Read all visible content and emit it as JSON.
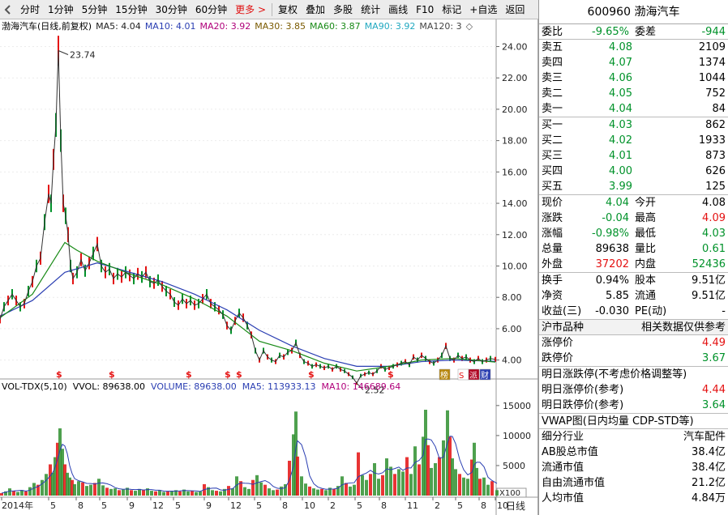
{
  "toolbar": {
    "items": [
      "分时",
      "1分钟",
      "5分钟",
      "15分钟",
      "30分钟",
      "60分钟"
    ],
    "more": "更多 >",
    "actions": [
      "复权",
      "叠加",
      "多股",
      "统计",
      "画线",
      "F10",
      "标记",
      "+自选",
      "返回"
    ]
  },
  "legend": {
    "title": "渤海汽车(日线,前复权)",
    "ma": [
      {
        "label": "MA5: 4.04",
        "color": "#202020"
      },
      {
        "label": "MA10: 4.01",
        "color": "#2a3eb2"
      },
      {
        "label": "MA20: 3.92",
        "color": "#b0007a"
      },
      {
        "label": "MA30: 3.85",
        "color": "#7a5a00"
      },
      {
        "label": "MA60: 3.87",
        "color": "#188a16"
      },
      {
        "label": "MA90: 3.92",
        "color": "#20a8c0"
      },
      {
        "label": "MA120: 3",
        "color": "#444444"
      }
    ]
  },
  "volume_legend": {
    "items": [
      {
        "label": "VOL-TDX(5,10)",
        "color": "#000000"
      },
      {
        "label": "VVOL: 89638.00",
        "color": "#000000"
      },
      {
        "label": "VOLUME: 89638.00",
        "color": "#2a3eb2"
      },
      {
        "label": "MA5: 113933.13",
        "color": "#2a3eb2"
      },
      {
        "label": "MA10: 146689.64",
        "color": "#b0007a"
      }
    ]
  },
  "colors": {
    "up": "#e41111",
    "down": "#00922a",
    "volume_bar_down": "#2f8f2f",
    "accent": "#e01010"
  },
  "chart_data": {
    "type": "line",
    "title": "渤海汽车(日线,前复权)",
    "price_axis": {
      "ticks": [
        "24.00",
        "22.00",
        "20.00",
        "18.00",
        "16.00",
        "14.00",
        "12.00",
        "10.00",
        "8.00",
        "6.00",
        "4.00"
      ],
      "ylim": [
        3.0,
        24.8
      ]
    },
    "volume_axis": {
      "ticks": [
        "15000",
        "10000",
        "5000"
      ],
      "unit": "X100",
      "ylim": [
        0,
        17000
      ]
    },
    "x_axis": {
      "labels": [
        "2014年",
        "5",
        "8",
        "5",
        "9",
        "12",
        "5",
        "9",
        "12",
        "5",
        "8",
        "10",
        "2",
        "5",
        "8",
        "11",
        "2",
        "5",
        "8",
        "10"
      ],
      "period": "日线"
    },
    "max_label": "23.74",
    "min_label": "2.52",
    "price_path": [
      [
        0,
        6.6
      ],
      [
        5,
        7.4
      ],
      [
        10,
        7.8
      ],
      [
        15,
        8.2
      ],
      [
        20,
        7.8
      ],
      [
        25,
        7.4
      ],
      [
        30,
        7.6
      ],
      [
        35,
        8.4
      ],
      [
        40,
        9.0
      ],
      [
        45,
        10.0
      ],
      [
        50,
        10.5
      ],
      [
        55,
        12.8
      ],
      [
        60,
        14.6
      ],
      [
        63,
        14.0
      ],
      [
        66,
        16.8
      ],
      [
        69,
        19.0
      ],
      [
        72,
        23.74
      ],
      [
        75,
        18.0
      ],
      [
        78,
        14.0
      ],
      [
        81,
        13.2
      ],
      [
        84,
        12.0
      ],
      [
        87,
        10.0
      ],
      [
        90,
        9.2
      ],
      [
        95,
        9.6
      ],
      [
        100,
        10.4
      ],
      [
        105,
        9.7
      ],
      [
        110,
        10.2
      ],
      [
        115,
        10.8
      ],
      [
        120,
        11.4
      ],
      [
        125,
        10.0
      ],
      [
        130,
        9.6
      ],
      [
        135,
        9.8
      ],
      [
        140,
        9.2
      ],
      [
        145,
        9.5
      ],
      [
        150,
        9.3
      ],
      [
        155,
        9.6
      ],
      [
        160,
        9.4
      ],
      [
        165,
        9.2
      ],
      [
        170,
        9.5
      ],
      [
        175,
        9.3
      ],
      [
        180,
        9.6
      ],
      [
        185,
        9.0
      ],
      [
        190,
        8.9
      ],
      [
        195,
        9.1
      ],
      [
        200,
        8.7
      ],
      [
        205,
        8.4
      ],
      [
        210,
        8.2
      ],
      [
        215,
        7.7
      ],
      [
        220,
        7.5
      ],
      [
        225,
        7.9
      ],
      [
        230,
        7.6
      ],
      [
        235,
        7.8
      ],
      [
        240,
        7.5
      ],
      [
        245,
        7.6
      ],
      [
        250,
        7.9
      ],
      [
        255,
        8.2
      ],
      [
        260,
        7.6
      ],
      [
        265,
        7.4
      ],
      [
        270,
        7.2
      ],
      [
        275,
        6.9
      ],
      [
        280,
        6.2
      ],
      [
        285,
        5.9
      ],
      [
        290,
        6.5
      ],
      [
        295,
        7.0
      ],
      [
        300,
        6.7
      ],
      [
        305,
        6.2
      ],
      [
        310,
        5.6
      ],
      [
        315,
        4.6
      ],
      [
        320,
        4.0
      ],
      [
        325,
        4.6
      ],
      [
        330,
        4.2
      ],
      [
        335,
        4.0
      ],
      [
        340,
        3.9
      ],
      [
        345,
        4.3
      ],
      [
        350,
        4.2
      ],
      [
        355,
        4.5
      ],
      [
        360,
        4.6
      ],
      [
        365,
        5.1
      ],
      [
        370,
        4.3
      ],
      [
        375,
        3.9
      ],
      [
        380,
        3.8
      ],
      [
        385,
        3.6
      ],
      [
        390,
        3.7
      ],
      [
        395,
        3.6
      ],
      [
        400,
        3.5
      ],
      [
        405,
        3.6
      ],
      [
        410,
        3.4
      ],
      [
        415,
        3.6
      ],
      [
        420,
        3.4
      ],
      [
        425,
        3.3
      ],
      [
        430,
        3.1
      ],
      [
        435,
        2.9
      ],
      [
        440,
        2.52
      ],
      [
        445,
        3.0
      ],
      [
        450,
        3.1
      ],
      [
        455,
        3.2
      ],
      [
        460,
        3.1
      ],
      [
        465,
        3.3
      ],
      [
        470,
        3.6
      ],
      [
        475,
        3.4
      ],
      [
        480,
        3.5
      ],
      [
        485,
        3.6
      ],
      [
        490,
        3.7
      ],
      [
        495,
        3.8
      ],
      [
        500,
        3.9
      ],
      [
        505,
        3.7
      ],
      [
        510,
        4.2
      ],
      [
        515,
        4.0
      ],
      [
        520,
        4.3
      ],
      [
        525,
        4.1
      ],
      [
        530,
        3.9
      ],
      [
        535,
        3.8
      ],
      [
        540,
        4.0
      ],
      [
        545,
        4.3
      ],
      [
        550,
        4.9
      ],
      [
        555,
        4.1
      ],
      [
        560,
        4.0
      ],
      [
        565,
        4.3
      ],
      [
        570,
        4.1
      ],
      [
        575,
        4.2
      ],
      [
        580,
        4.0
      ],
      [
        585,
        3.9
      ],
      [
        590,
        4.1
      ],
      [
        595,
        3.9
      ],
      [
        600,
        4.0
      ],
      [
        605,
        4.1
      ],
      [
        611,
        4.04
      ]
    ],
    "ma_long_path": [
      [
        0,
        6.8
      ],
      [
        40,
        7.8
      ],
      [
        80,
        9.6
      ],
      [
        120,
        10.2
      ],
      [
        160,
        9.6
      ],
      [
        200,
        9.0
      ],
      [
        240,
        8.2
      ],
      [
        280,
        7.2
      ],
      [
        320,
        5.9
      ],
      [
        360,
        4.9
      ],
      [
        400,
        4.1
      ],
      [
        440,
        3.6
      ],
      [
        480,
        3.6
      ],
      [
        520,
        3.9
      ],
      [
        560,
        4.0
      ],
      [
        611,
        3.92
      ]
    ],
    "ma_mid_path": [
      [
        0,
        6.7
      ],
      [
        40,
        8.2
      ],
      [
        80,
        11.5
      ],
      [
        95,
        11.0
      ],
      [
        120,
        10.3
      ],
      [
        160,
        9.5
      ],
      [
        200,
        8.8
      ],
      [
        240,
        7.9
      ],
      [
        280,
        6.8
      ],
      [
        320,
        5.2
      ],
      [
        360,
        4.6
      ],
      [
        400,
        3.8
      ],
      [
        440,
        3.3
      ],
      [
        480,
        3.6
      ],
      [
        520,
        4.0
      ],
      [
        560,
        4.1
      ],
      [
        611,
        3.87
      ]
    ],
    "volume_bars": [
      [
        0,
        400
      ],
      [
        5,
        700
      ],
      [
        10,
        1200
      ],
      [
        15,
        800
      ],
      [
        20,
        600
      ],
      [
        25,
        900
      ],
      [
        30,
        700
      ],
      [
        35,
        1400
      ],
      [
        40,
        2100
      ],
      [
        45,
        1800
      ],
      [
        50,
        2600
      ],
      [
        55,
        3600
      ],
      [
        60,
        5200
      ],
      [
        63,
        3800
      ],
      [
        66,
        6400
      ],
      [
        69,
        8800
      ],
      [
        72,
        11200
      ],
      [
        75,
        7800
      ],
      [
        78,
        5200
      ],
      [
        81,
        3800
      ],
      [
        84,
        3000
      ],
      [
        87,
        2600
      ],
      [
        90,
        1900
      ],
      [
        95,
        2400
      ],
      [
        100,
        2200
      ],
      [
        105,
        1600
      ],
      [
        110,
        1800
      ],
      [
        115,
        2100
      ],
      [
        120,
        2800
      ],
      [
        125,
        1700
      ],
      [
        130,
        1300
      ],
      [
        135,
        1100
      ],
      [
        140,
        1200
      ],
      [
        145,
        900
      ],
      [
        150,
        1000
      ],
      [
        155,
        1300
      ],
      [
        160,
        900
      ],
      [
        165,
        800
      ],
      [
        170,
        1100
      ],
      [
        175,
        900
      ],
      [
        180,
        1200
      ],
      [
        185,
        800
      ],
      [
        190,
        700
      ],
      [
        195,
        900
      ],
      [
        200,
        600
      ],
      [
        205,
        700
      ],
      [
        210,
        800
      ],
      [
        215,
        900
      ],
      [
        220,
        700
      ],
      [
        225,
        1000
      ],
      [
        230,
        700
      ],
      [
        235,
        800
      ],
      [
        240,
        600
      ],
      [
        245,
        700
      ],
      [
        250,
        1900
      ],
      [
        255,
        1400
      ],
      [
        260,
        900
      ],
      [
        265,
        800
      ],
      [
        270,
        700
      ],
      [
        275,
        1100
      ],
      [
        280,
        1600
      ],
      [
        285,
        1200
      ],
      [
        290,
        3200
      ],
      [
        295,
        2400
      ],
      [
        300,
        1400
      ],
      [
        305,
        1100
      ],
      [
        310,
        2600
      ],
      [
        315,
        3400
      ],
      [
        320,
        2200
      ],
      [
        325,
        1800
      ],
      [
        330,
        1200
      ],
      [
        335,
        900
      ],
      [
        340,
        1000
      ],
      [
        345,
        1500
      ],
      [
        350,
        1900
      ],
      [
        355,
        5800
      ],
      [
        360,
        10200
      ],
      [
        363,
        14000
      ],
      [
        365,
        6500
      ],
      [
        370,
        3200
      ],
      [
        375,
        2000
      ],
      [
        380,
        1500
      ],
      [
        385,
        1200
      ],
      [
        390,
        1000
      ],
      [
        395,
        1100
      ],
      [
        400,
        900
      ],
      [
        405,
        1300
      ],
      [
        410,
        1100
      ],
      [
        415,
        1600
      ],
      [
        420,
        3200
      ],
      [
        425,
        2100
      ],
      [
        430,
        1500
      ],
      [
        435,
        1800
      ],
      [
        440,
        7200
      ],
      [
        445,
        3400
      ],
      [
        450,
        2600
      ],
      [
        455,
        3600
      ],
      [
        460,
        5400
      ],
      [
        465,
        2800
      ],
      [
        470,
        3400
      ],
      [
        475,
        6200
      ],
      [
        480,
        4800
      ],
      [
        485,
        3600
      ],
      [
        490,
        4400
      ],
      [
        495,
        4000
      ],
      [
        500,
        6400
      ],
      [
        505,
        3600
      ],
      [
        510,
        8200
      ],
      [
        515,
        5200
      ],
      [
        520,
        9800
      ],
      [
        523,
        14300
      ],
      [
        526,
        8400
      ],
      [
        530,
        4600
      ],
      [
        535,
        5400
      ],
      [
        540,
        6400
      ],
      [
        545,
        9200
      ],
      [
        550,
        14200
      ],
      [
        553,
        9800
      ],
      [
        556,
        6200
      ],
      [
        560,
        4400
      ],
      [
        565,
        3600
      ],
      [
        570,
        3000
      ],
      [
        575,
        2800
      ],
      [
        580,
        6000
      ],
      [
        583,
        8800
      ],
      [
        586,
        4600
      ],
      [
        590,
        2800
      ],
      [
        595,
        3000
      ],
      [
        600,
        1800
      ],
      [
        605,
        2400
      ],
      [
        611,
        900
      ]
    ]
  },
  "markers": {
    "s_positions": [
      72,
      137,
      232,
      280,
      294,
      383,
      481,
      580
    ],
    "boxes": [
      {
        "label": "榜",
        "bg": "#b8860b",
        "fg": "#ffffff"
      },
      {
        "label": "S",
        "bg": "#ffffff",
        "fg": "#e41111"
      },
      {
        "label": "派",
        "bg": "#b00020",
        "fg": "#ffffff"
      },
      {
        "label": "财",
        "bg": "#2a3eb2",
        "fg": "#ffffff"
      }
    ]
  },
  "quote": {
    "code_name": "600960 渤海汽车",
    "wei": {
      "label": "委比",
      "value": "-9.65%",
      "label2": "委差",
      "value2": "-944"
    },
    "sell": [
      {
        "label": "卖五",
        "price": "4.08",
        "vol": "2109"
      },
      {
        "label": "卖四",
        "price": "4.07",
        "vol": "1374"
      },
      {
        "label": "卖三",
        "price": "4.06",
        "vol": "1044"
      },
      {
        "label": "卖二",
        "price": "4.05",
        "vol": "752"
      },
      {
        "label": "卖一",
        "price": "4.04",
        "vol": "84"
      }
    ],
    "buy": [
      {
        "label": "买一",
        "price": "4.03",
        "vol": "862"
      },
      {
        "label": "买二",
        "price": "4.02",
        "vol": "1933"
      },
      {
        "label": "买三",
        "price": "4.01",
        "vol": "873"
      },
      {
        "label": "买四",
        "price": "4.00",
        "vol": "626"
      },
      {
        "label": "买五",
        "price": "3.99",
        "vol": "125"
      }
    ],
    "stats1": [
      {
        "l1": "现价",
        "v1": "4.04",
        "c1": "green",
        "l2": "今开",
        "v2": "4.08",
        "c2": "blk"
      },
      {
        "l1": "涨跌",
        "v1": "-0.04",
        "c1": "green",
        "l2": "最高",
        "v2": "4.09",
        "c2": "red"
      },
      {
        "l1": "涨幅",
        "v1": "-0.98%",
        "c1": "green",
        "l2": "最低",
        "v2": "4.03",
        "c2": "green"
      },
      {
        "l1": "总量",
        "v1": "89638",
        "c1": "blk",
        "l2": "量比",
        "v2": "0.61",
        "c2": "green"
      },
      {
        "l1": "外盘",
        "v1": "37202",
        "c1": "red",
        "l2": "内盘",
        "v2": "52436",
        "c2": "green"
      }
    ],
    "stats2": [
      {
        "l1": "换手",
        "v1": "0.94%",
        "l2": "股本",
        "v2": "9.51亿"
      },
      {
        "l1": "净资",
        "v1": "5.85",
        "l2": "流通",
        "v2": "9.51亿"
      },
      {
        "l1": "收益(三)",
        "v1": "-0.030",
        "l2": "PE(动)",
        "v2": "-"
      }
    ],
    "market": {
      "label": "沪市品种",
      "note": "相关数据仅供参考"
    },
    "limits": [
      {
        "label": "涨停价",
        "value": "4.49",
        "color": "red"
      },
      {
        "label": "跌停价",
        "value": "3.67",
        "color": "green"
      }
    ],
    "next_day": {
      "title": "明日涨跌停(不考虑价格调整等)",
      "rows": [
        {
          "label": "明日涨停价(参考)",
          "value": "4.44",
          "color": "red"
        },
        {
          "label": "明日跌停价(参考)",
          "value": "3.64",
          "color": "green"
        }
      ]
    },
    "vwap": "VWAP图(日内均量 CDP-STD等)",
    "industry": {
      "label": "细分行业",
      "value": "汽车配件"
    },
    "caps": [
      {
        "label": "AB股总市值",
        "value": "38.4亿"
      },
      {
        "label": "流通市值",
        "value": "38.4亿"
      },
      {
        "label": "自由流通市值",
        "value": "21.2亿"
      },
      {
        "label": "人均市值",
        "value": "4.84万"
      }
    ]
  }
}
